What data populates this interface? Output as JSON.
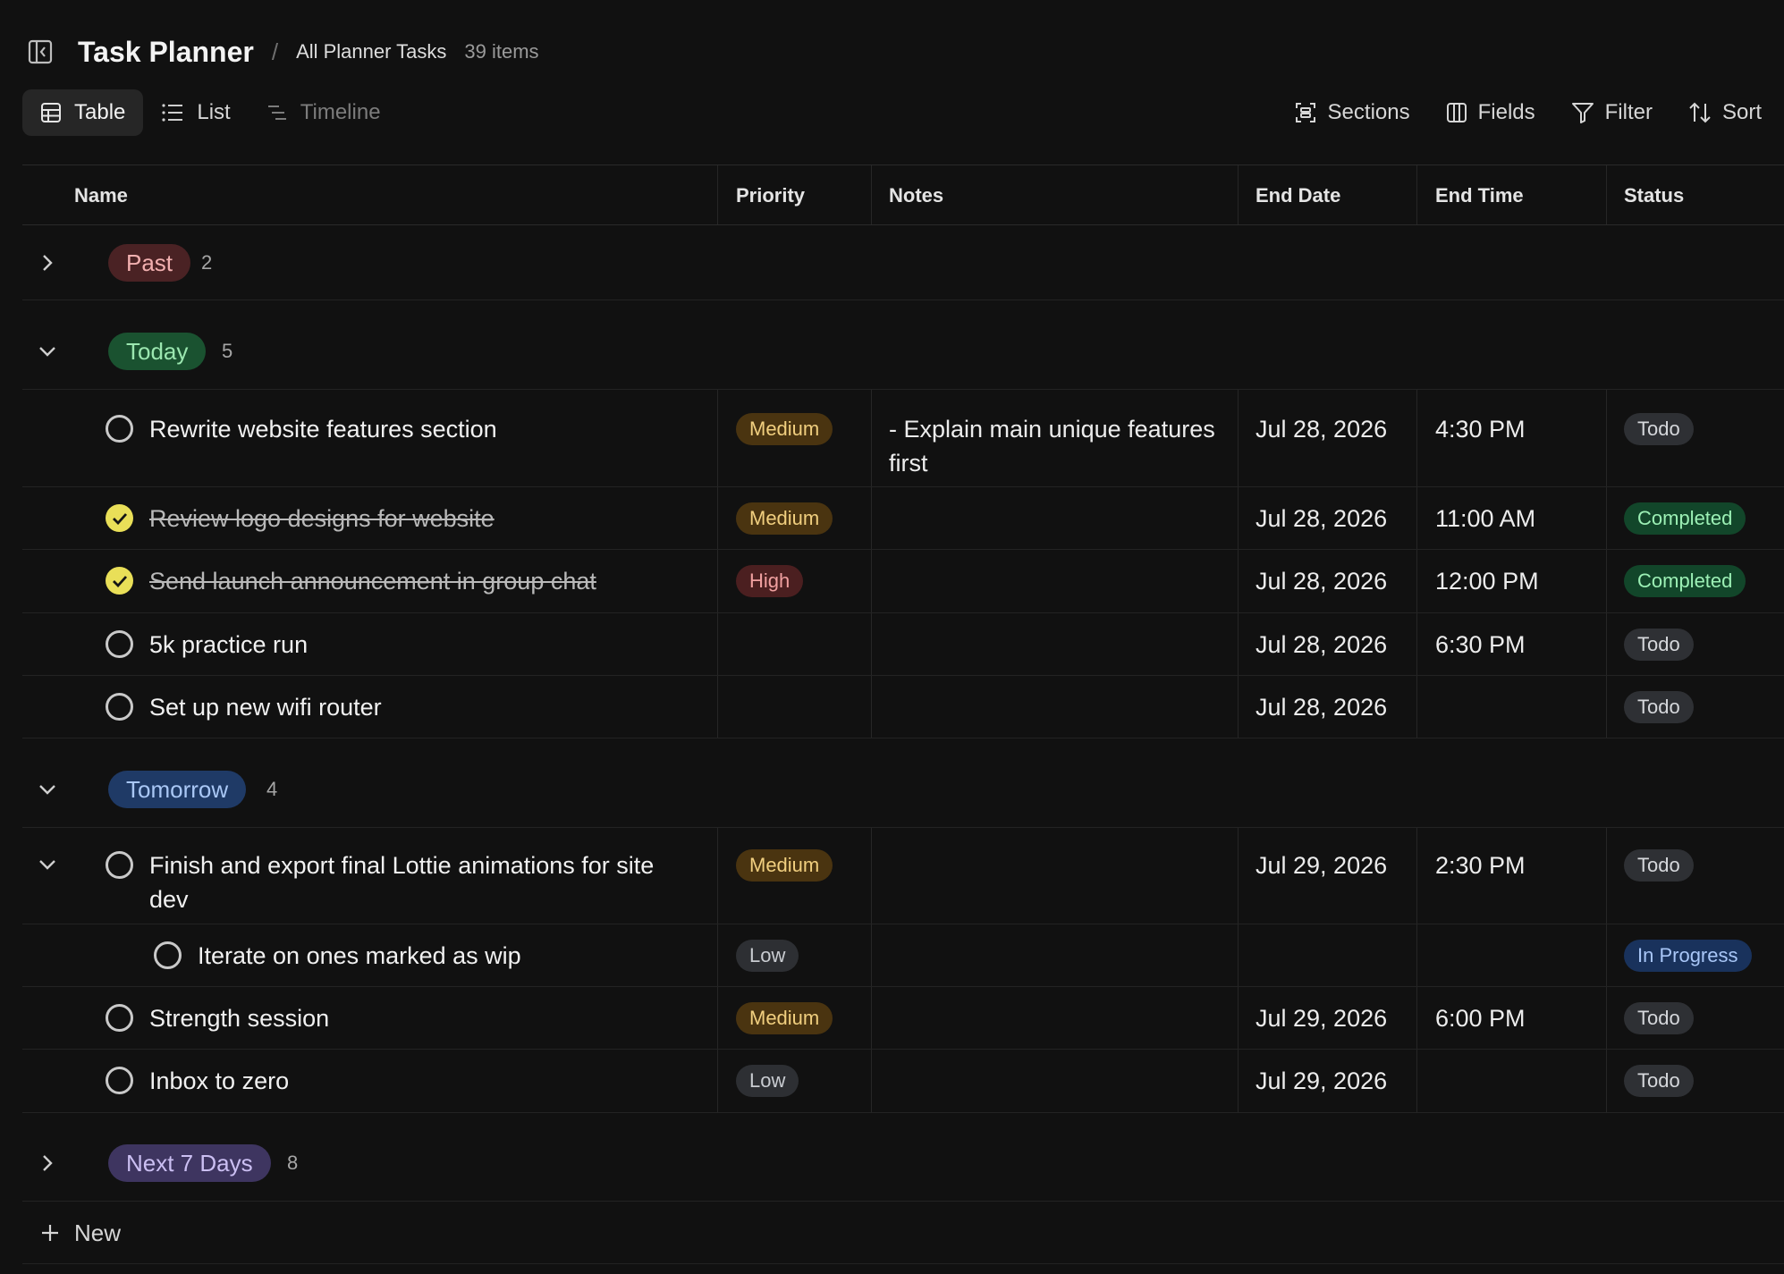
{
  "header": {
    "title": "Task Planner",
    "separator": "/",
    "view_name": "All Planner Tasks",
    "item_count": "39 items"
  },
  "views": [
    {
      "label": "Table",
      "icon": "table-icon",
      "active": true
    },
    {
      "label": "List",
      "icon": "list-icon",
      "active": false
    },
    {
      "label": "Timeline",
      "icon": "timeline-icon",
      "active": false
    }
  ],
  "tools": [
    {
      "label": "Sections",
      "icon": "sections-icon"
    },
    {
      "label": "Fields",
      "icon": "fields-icon"
    },
    {
      "label": "Filter",
      "icon": "filter-icon"
    },
    {
      "label": "Sort",
      "icon": "sort-icon"
    }
  ],
  "columns": [
    "Name",
    "Priority",
    "Notes",
    "End Date",
    "End Time",
    "Status"
  ],
  "groups": {
    "past": {
      "label": "Past",
      "count": "2"
    },
    "today": {
      "label": "Today",
      "count": "5"
    },
    "tomorrow": {
      "label": "Tomorrow",
      "count": "4"
    },
    "next7": {
      "label": "Next 7 Days",
      "count": "8"
    }
  },
  "tasks": [
    {
      "name": "Rewrite website features section",
      "done": false,
      "priority": "Medium",
      "notes": "- Explain main unique features first",
      "end_date": "Jul 28, 2026",
      "end_time": "4:30 PM",
      "status": "Todo"
    },
    {
      "name": "Review logo designs for website",
      "done": true,
      "priority": "Medium",
      "notes": "",
      "end_date": "Jul 28, 2026",
      "end_time": "11:00 AM",
      "status": "Completed"
    },
    {
      "name": "Send launch announcement in group chat",
      "done": true,
      "priority": "High",
      "notes": "",
      "end_date": "Jul 28, 2026",
      "end_time": "12:00 PM",
      "status": "Completed"
    },
    {
      "name": "5k practice run",
      "done": false,
      "priority": "",
      "notes": "",
      "end_date": "Jul 28, 2026",
      "end_time": "6:30 PM",
      "status": "Todo"
    },
    {
      "name": "Set up new wifi router",
      "done": false,
      "priority": "",
      "notes": "",
      "end_date": "Jul 28, 2026",
      "end_time": "",
      "status": "Todo"
    },
    {
      "name": "Finish and export final Lottie animations for site dev",
      "done": false,
      "priority": "Medium",
      "notes": "",
      "end_date": "Jul 29, 2026",
      "end_time": "2:30 PM",
      "status": "Todo"
    },
    {
      "name": "Iterate on ones marked as wip",
      "done": false,
      "priority": "Low",
      "notes": "",
      "end_date": "",
      "end_time": "",
      "status": "In Progress"
    },
    {
      "name": "Strength session",
      "done": false,
      "priority": "Medium",
      "notes": "",
      "end_date": "Jul 29, 2026",
      "end_time": "6:00 PM",
      "status": "Todo"
    },
    {
      "name": "Inbox to zero",
      "done": false,
      "priority": "Low",
      "notes": "",
      "end_date": "Jul 29, 2026",
      "end_time": "",
      "status": "Todo"
    }
  ],
  "footer": {
    "new_label": "New"
  },
  "colors": {
    "background": "#111111",
    "check_fill": "#e9df58",
    "past": "#4a2224",
    "today": "#1a5230",
    "tomorrow": "#1f3a66",
    "next7": "#3e3560"
  }
}
